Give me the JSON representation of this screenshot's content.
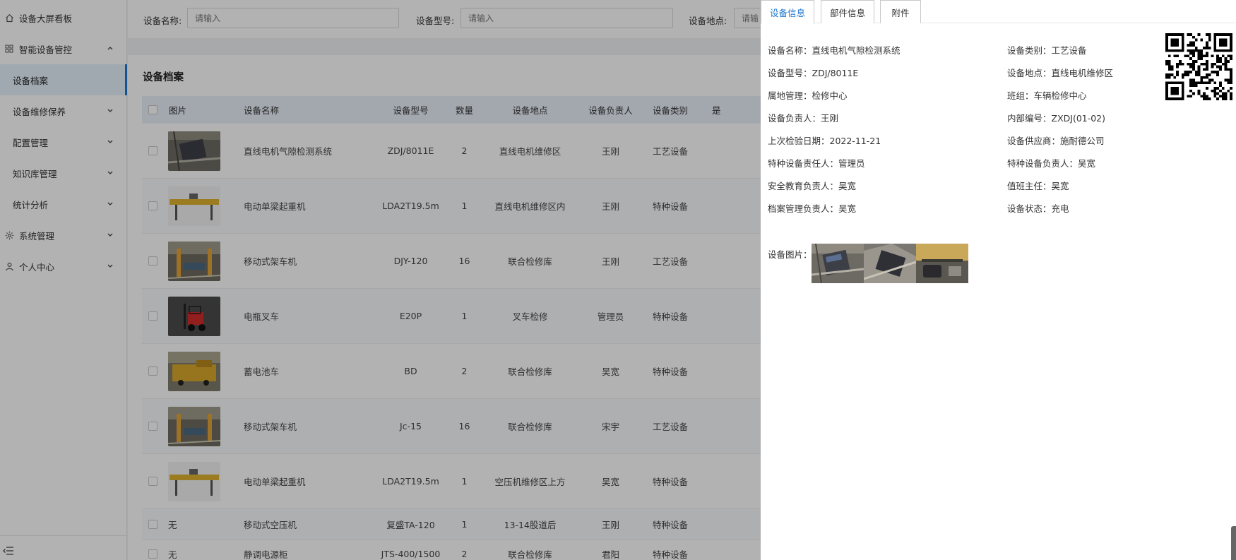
{
  "sidebar": {
    "items": [
      {
        "label": "设备大屏看板",
        "icon": "home-icon"
      },
      {
        "label": "智能设备管控",
        "icon": "grid-icon",
        "chevron": "chevron-up-icon"
      },
      {
        "label": "设备档案",
        "active": true
      },
      {
        "label": "设备维修保养",
        "chevron": "chevron-down-icon"
      },
      {
        "label": "配置管理",
        "chevron": "chevron-down-icon"
      },
      {
        "label": "知识库管理",
        "chevron": "chevron-down-icon"
      },
      {
        "label": "统计分析",
        "chevron": "chevron-down-icon"
      },
      {
        "label": "系统管理",
        "icon": "gear-icon",
        "chevron": "chevron-down-icon"
      },
      {
        "label": "个人中心",
        "icon": "user-icon",
        "chevron": "chevron-down-icon"
      }
    ],
    "collapse_icon": "menu-fold-icon"
  },
  "filters": {
    "name_label": "设备名称:",
    "name_placeholder": "请输入",
    "model_label": "设备型号:",
    "model_placeholder": "请输入",
    "location_label": "设备地点:",
    "location_placeholder": "请输"
  },
  "panel": {
    "title": "设备档案",
    "columns": [
      "图片",
      "设备名称",
      "设备型号",
      "数量",
      "设备地点",
      "设备负责人",
      "设备类别",
      "是"
    ],
    "rows": [
      {
        "image": "electric-motor-photo",
        "name": "直线电机气隙检测系统",
        "model": "ZDJ/8011E",
        "qty": "2",
        "location": "直线电机维修区",
        "owner": "王刚",
        "category": "工艺设备"
      },
      {
        "image": "crane-photo",
        "name": "电动单梁起重机",
        "model": "LDA2T19.5m",
        "qty": "1",
        "location": "直线电机维修区内",
        "owner": "王刚",
        "category": "特种设备"
      },
      {
        "image": "lift-jack-photo",
        "name": "移动式架车机",
        "model": "DJY-120",
        "qty": "16",
        "location": "联合检修库",
        "owner": "王刚",
        "category": "工艺设备"
      },
      {
        "image": "forklift-photo",
        "name": "电瓶叉车",
        "model": "E20P",
        "qty": "1",
        "location": "叉车检修",
        "owner": "管理员",
        "category": "特种设备"
      },
      {
        "image": "battery-car-photo",
        "name": "蓄电池车",
        "model": "BD",
        "qty": "2",
        "location": "联合检修库",
        "owner": "吴宽",
        "category": "特种设备"
      },
      {
        "image": "lift-jack-photo",
        "name": "移动式架车机",
        "model": "Jc-15",
        "qty": "16",
        "location": "联合检修库",
        "owner": "宋宇",
        "category": "工艺设备"
      },
      {
        "image": "crane-photo",
        "name": "电动单梁起重机",
        "model": "LDA2T19.5m",
        "qty": "1",
        "location": "空压机维修区上方",
        "owner": "吴宽",
        "category": "特种设备"
      },
      {
        "image_text": "无",
        "name": "移动式空压机",
        "model": "复盛TA-120",
        "qty": "1",
        "location": "13-14股道后",
        "owner": "王刚",
        "category": "特种设备"
      },
      {
        "image_text": "无",
        "name": "静调电源柜",
        "model": "JTS-400/1500",
        "qty": "2",
        "location": "联合检修库",
        "owner": "君阳",
        "category": "特种设备"
      }
    ]
  },
  "drawer": {
    "tabs": [
      "设备信息",
      "部件信息",
      "附件"
    ],
    "active_tab": 0,
    "left_fields": [
      "设备名称：直线电机气隙检测系统",
      "设备型号：ZDJ/8011E",
      "属地管理：检修中心",
      "设备负责人：王刚",
      "上次检验日期：2022-11-21",
      "特种设备责任人：管理员",
      "安全教育负责人：吴宽",
      "档案管理负责人：吴宽"
    ],
    "right_fields": [
      "设备类别：工艺设备",
      "设备地点：直线电机维修区",
      "班组：车辆检修中心",
      "内部编号：ZXDJ(01-02)",
      "设备供应商：施耐德公司",
      "特种设备负责人：吴宽",
      "值班主任：吴宽",
      "设备状态：充电"
    ],
    "image_label": "设备图片：",
    "qr_icon": "qr-code-icon"
  },
  "colors": {
    "accent": "#1f78d1",
    "table_header": "#eaf1fb",
    "overlay": "rgba(0,0,0,0.3)"
  }
}
